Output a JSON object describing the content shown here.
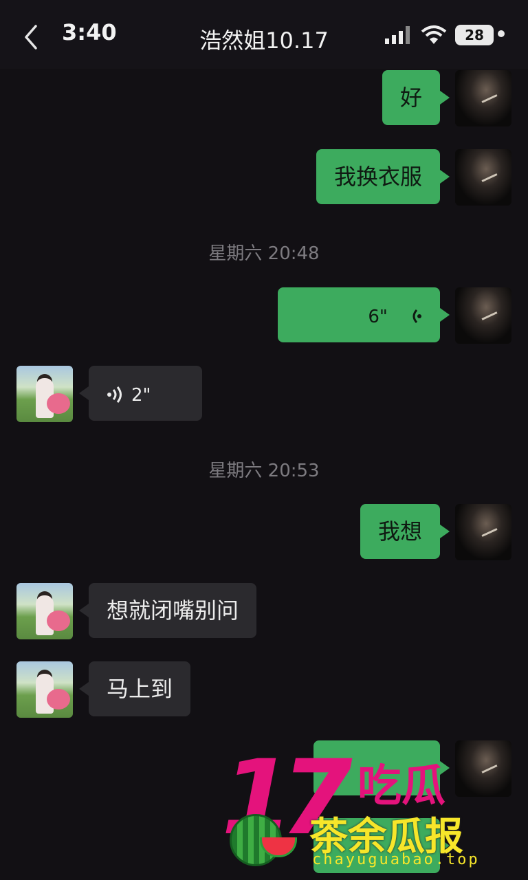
{
  "status_bar": {
    "time": "3:40",
    "title": "浩然姐10.17",
    "battery": "28"
  },
  "messages": [
    {
      "from": "me",
      "type": "text",
      "text": "好"
    },
    {
      "from": "me",
      "type": "text",
      "text": "我换衣服"
    },
    {
      "type": "timestamp",
      "text": "星期六 20:48"
    },
    {
      "from": "me",
      "type": "voice",
      "duration": "6\""
    },
    {
      "from": "her",
      "type": "voice",
      "duration": "2\""
    },
    {
      "type": "timestamp",
      "text": "星期六 20:53"
    },
    {
      "from": "me",
      "type": "text",
      "text": "我想"
    },
    {
      "from": "her",
      "type": "text",
      "text": "想就闭嘴别问"
    },
    {
      "from": "her",
      "type": "text",
      "text": "马上到"
    }
  ],
  "watermark": {
    "number": "17",
    "chi": "吃瓜",
    "brand": "茶余瓜报",
    "url": "chayuguabao.top"
  }
}
